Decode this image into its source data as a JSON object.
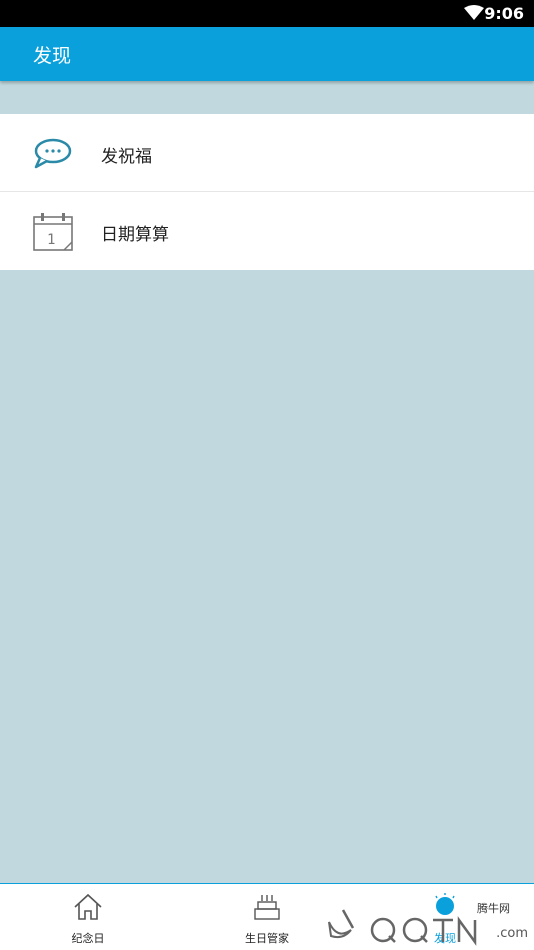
{
  "status_bar": {
    "time": "9:06",
    "wifi_icon": "wifi-icon"
  },
  "app_bar": {
    "title": "发现"
  },
  "list": {
    "items": [
      {
        "label": "发祝福",
        "icon": "chat-bubble-icon"
      },
      {
        "label": "日期算算",
        "icon": "calendar-icon"
      }
    ]
  },
  "bottom_nav": {
    "items": [
      {
        "label": "纪念日",
        "icon": "home-icon"
      },
      {
        "label": "生日管家",
        "icon": "cake-icon"
      },
      {
        "label": "发现",
        "icon": "discover-icon",
        "active": true
      }
    ]
  },
  "watermark": {
    "text": "腾牛网",
    "logo": "qqtn-logo",
    "domain": ".com"
  },
  "colors": {
    "accent": "#0aa0dc",
    "background": "#c1d9de",
    "icon_teal": "#2a8aa8"
  }
}
